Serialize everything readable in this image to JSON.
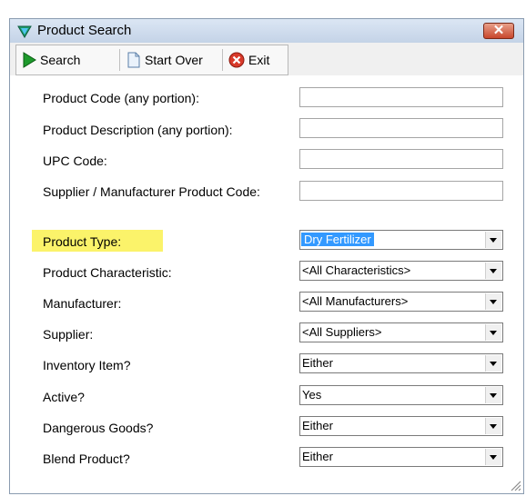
{
  "window": {
    "title": "Product Search"
  },
  "toolbar": {
    "search_label": "Search",
    "start_over_label": "Start Over",
    "exit_label": "Exit"
  },
  "fields": {
    "product_code": {
      "label": "Product Code (any portion):",
      "value": ""
    },
    "product_description": {
      "label": "Product Description (any portion):",
      "value": ""
    },
    "upc_code": {
      "label": "UPC Code:",
      "value": ""
    },
    "supplier_code": {
      "label": "Supplier / Manufacturer Product Code:",
      "value": ""
    },
    "product_type": {
      "label": "Product Type:",
      "value": "Dry Fertilizer"
    },
    "product_characteristic": {
      "label": "Product Characteristic:",
      "value": "<All Characteristics>"
    },
    "manufacturer": {
      "label": "Manufacturer:",
      "value": "<All Manufacturers>"
    },
    "supplier": {
      "label": "Supplier:",
      "value": "<All Suppliers>"
    },
    "inventory_item": {
      "label": "Inventory Item?",
      "value": "Either"
    },
    "active": {
      "label": "Active?",
      "value": "Yes"
    },
    "dangerous_goods": {
      "label": "Dangerous Goods?",
      "value": "Either"
    },
    "blend_product": {
      "label": "Blend Product?",
      "value": "Either"
    }
  },
  "colors": {
    "highlight": "#fbf36a",
    "selection": "#3399ff",
    "close_button": "#c8462c"
  },
  "icons": {
    "title": "triangle-logo-icon",
    "search": "play-icon",
    "start_over": "document-icon",
    "exit": "close-circle-icon"
  }
}
